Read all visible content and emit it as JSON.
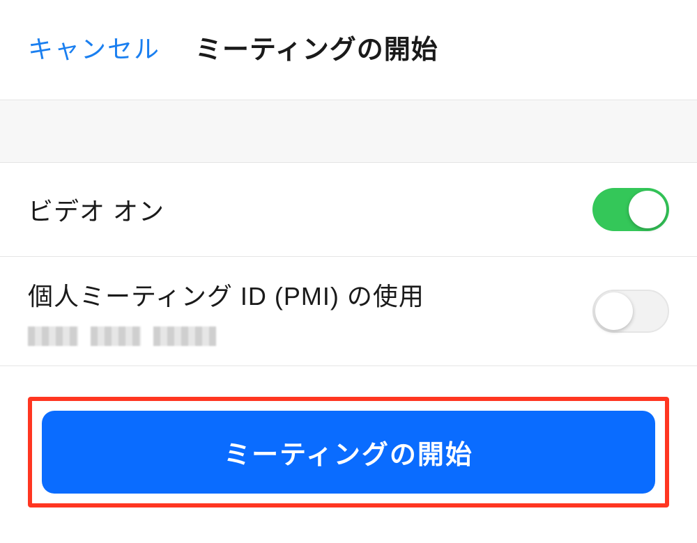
{
  "header": {
    "cancel_label": "キャンセル",
    "title": "ミーティングの開始"
  },
  "settings": {
    "video_on": {
      "label": "ビデオ オン",
      "value": true
    },
    "pmi": {
      "label": "個人ミーティング ID (PMI) の使用",
      "value": false
    }
  },
  "actions": {
    "start_meeting_label": "ミーティングの開始"
  },
  "colors": {
    "accent_link": "#1a7ff0",
    "primary_button": "#0a6cff",
    "toggle_on": "#34c759",
    "highlight_border": "#ff3621"
  }
}
